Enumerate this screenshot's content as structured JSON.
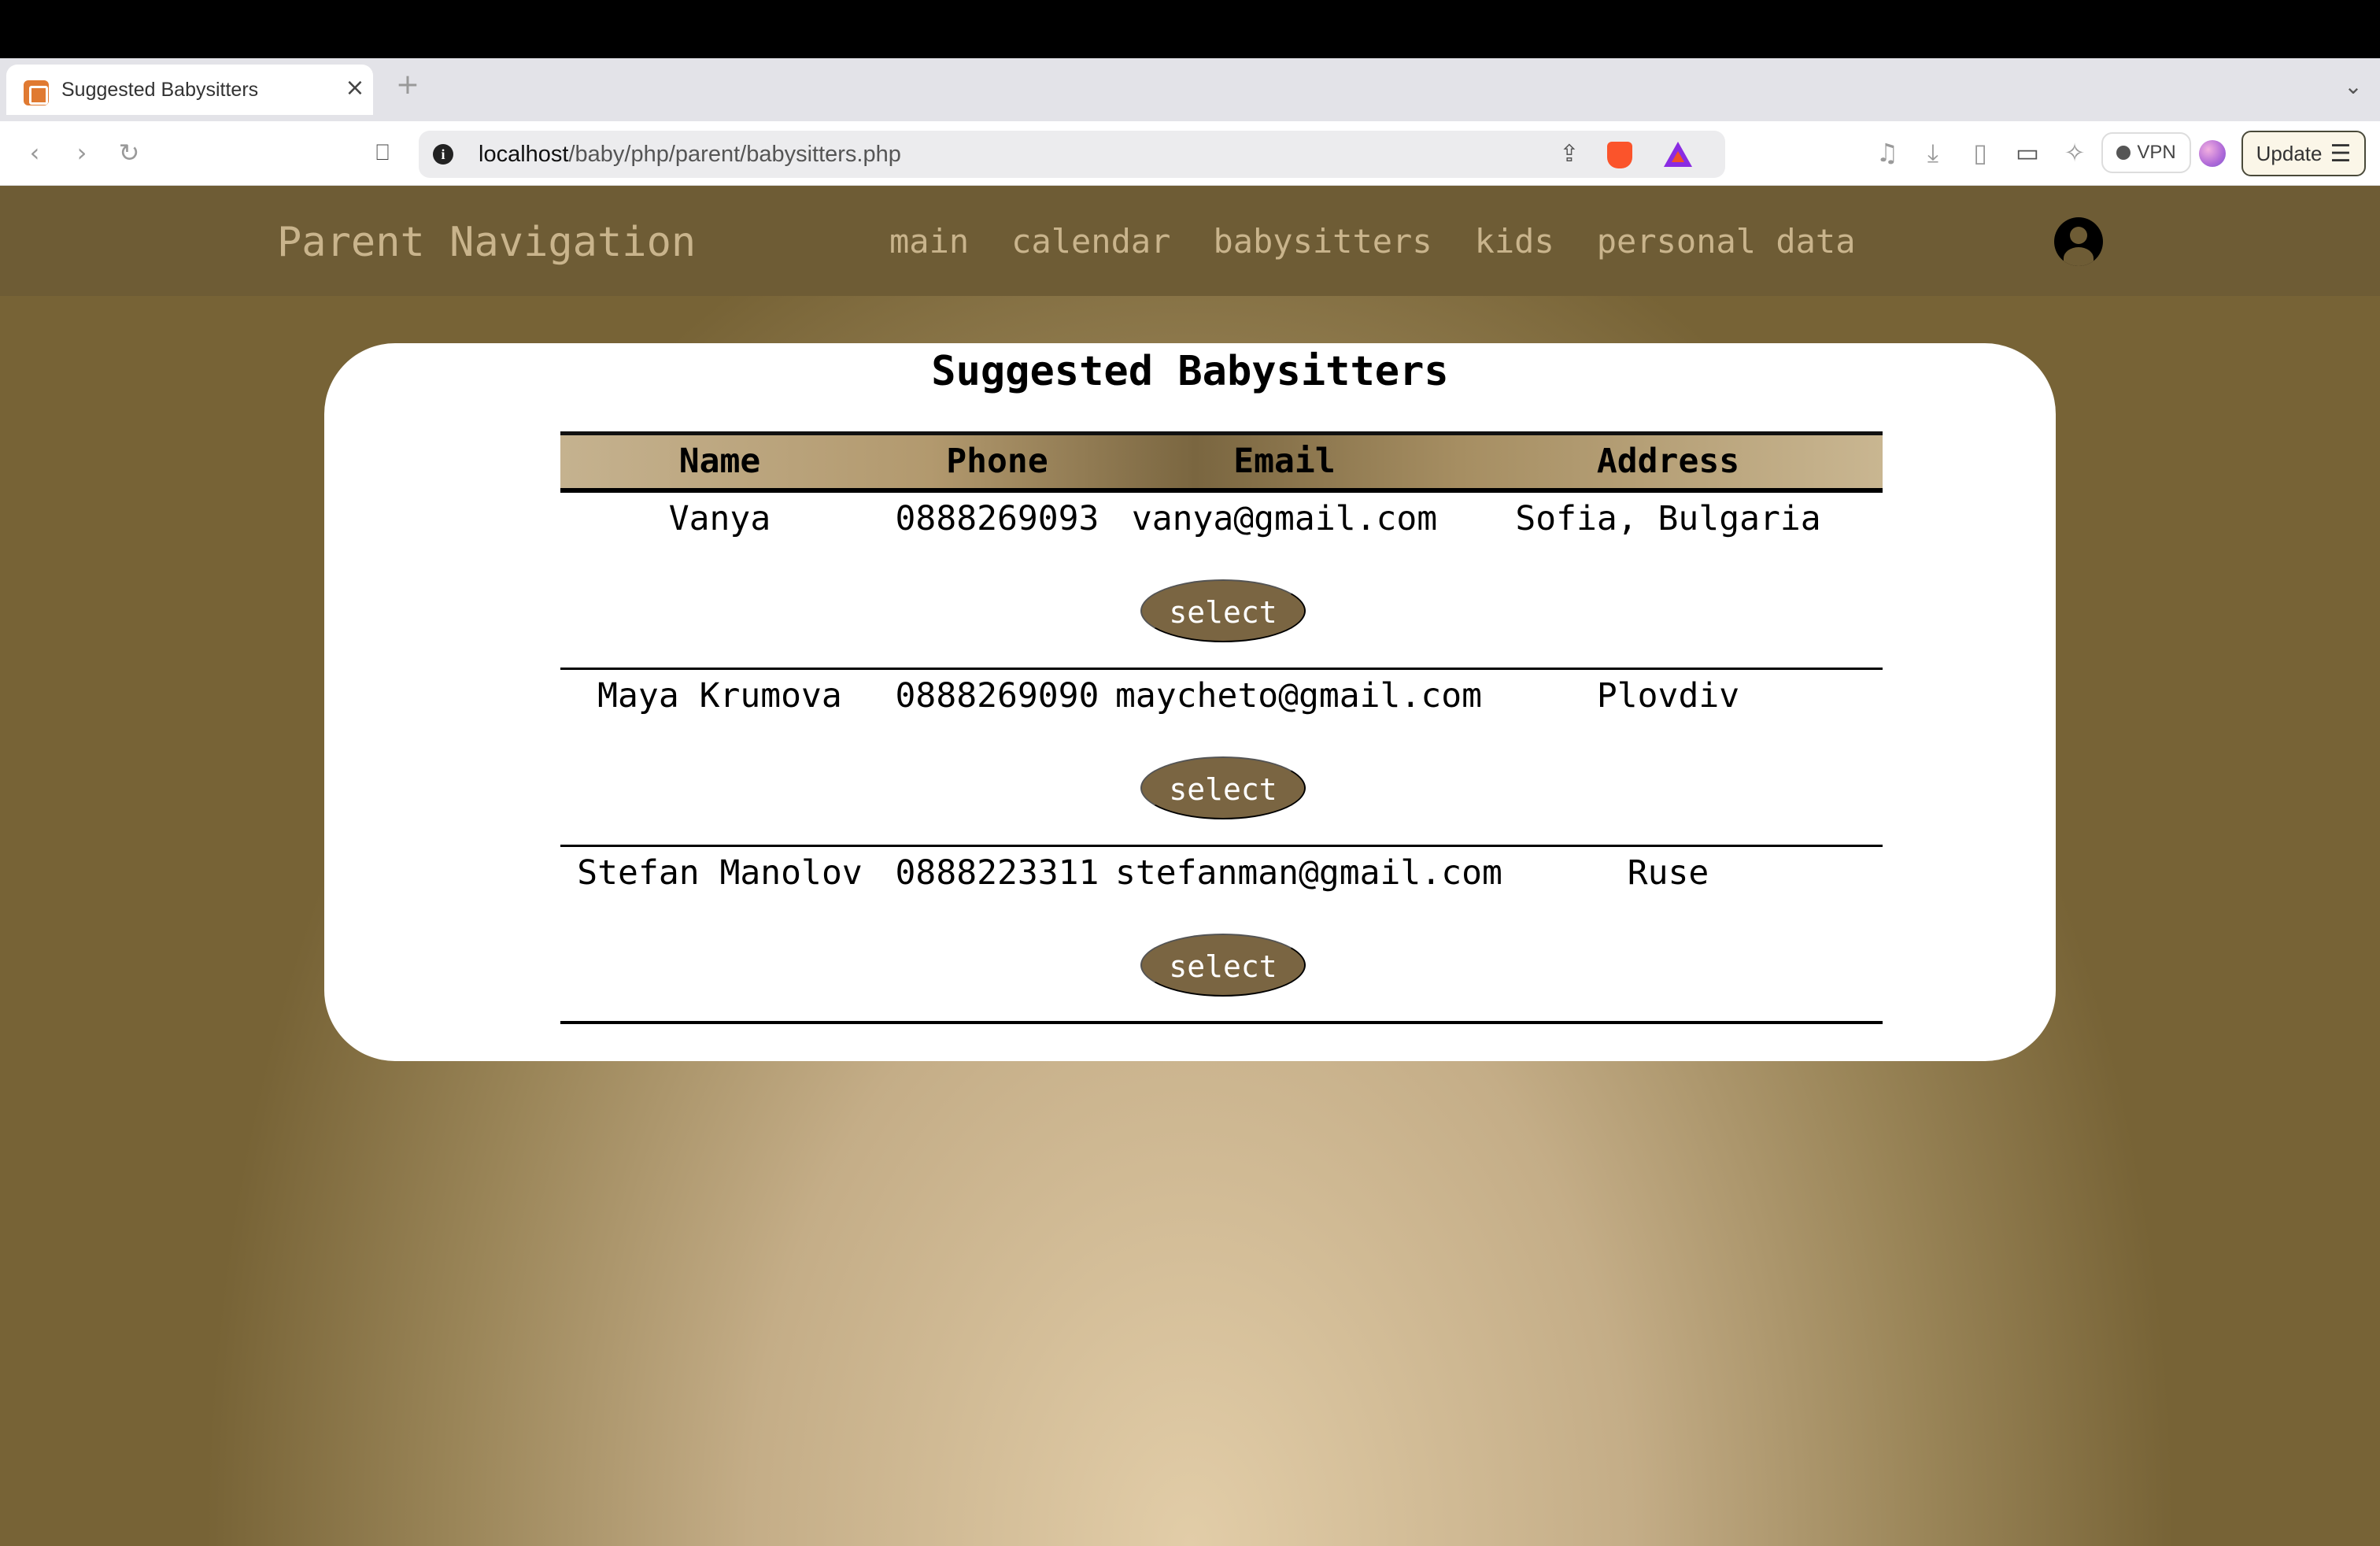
{
  "browser": {
    "tab_title": "Suggested Babysitters",
    "tab_close": "×",
    "new_tab": "+",
    "url_host": "localhost",
    "url_path": "/baby/php/parent/babysitters.php",
    "vpn_label": "VPN",
    "update_label": "Update",
    "icons": [
      "back-icon",
      "forward-icon",
      "reload-icon",
      "bookmark-icon",
      "site-info-icon",
      "share-icon",
      "brave-shields-icon",
      "brave-rewards-icon",
      "media-icon",
      "download-icon",
      "sidebar-icon",
      "wallet-icon",
      "leo-ai-icon",
      "menu-icon"
    ]
  },
  "nav": {
    "brand": "Parent Navigation",
    "links": [
      "main",
      "calendar",
      "babysitters",
      "kids",
      "personal data"
    ]
  },
  "page": {
    "title": "Suggested Babysitters",
    "columns": [
      "Name",
      "Phone",
      "Email",
      "Address"
    ],
    "rows": [
      {
        "name": "Vanya",
        "phone": "0888269093",
        "email": "vanya@gmail.com",
        "address": "Sofia, Bulgaria",
        "action": "select"
      },
      {
        "name": "Maya Krumova",
        "phone": "0888269090",
        "email": "maycheto@gmail.com",
        "address": "Plovdiv",
        "action": "select"
      },
      {
        "name": "Stefan Manolov",
        "phone": "0888223311",
        "email": "stefanman@gmail.com",
        "address": "Ruse",
        "action": "select"
      }
    ]
  },
  "colors": {
    "nav_bg": "#6e5c35",
    "nav_text": "#c9b48c",
    "button_bg": "#7a6542",
    "card_bg": "#ffffff"
  }
}
